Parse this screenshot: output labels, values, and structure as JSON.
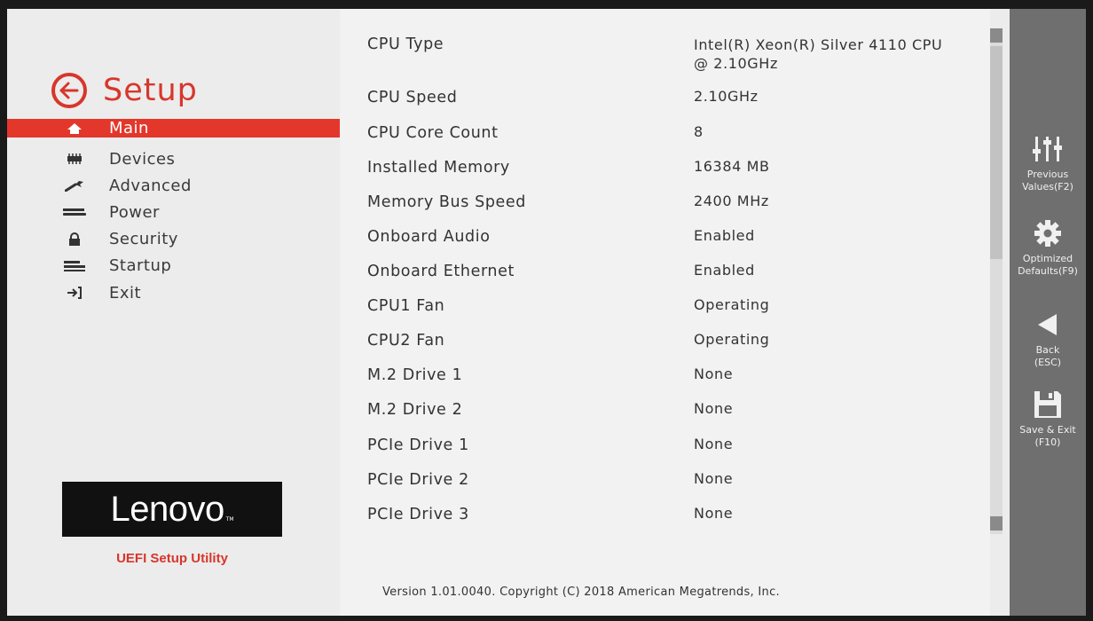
{
  "nav": {
    "title": "Setup",
    "items": [
      {
        "label": "Main",
        "icon": "home-icon",
        "active": true
      },
      {
        "label": "Devices",
        "icon": "chip-icon"
      },
      {
        "label": "Advanced",
        "icon": "wrench-icon"
      },
      {
        "label": "Power",
        "icon": "power-icon"
      },
      {
        "label": "Security",
        "icon": "lock-icon"
      },
      {
        "label": "Startup",
        "icon": "startup-icon"
      },
      {
        "label": "Exit",
        "icon": "exit-icon"
      }
    ],
    "brand": "Lenovo",
    "brand_tm": "TM",
    "subtitle": "UEFI Setup Utility"
  },
  "main": {
    "rows": [
      {
        "label": "CPU Type",
        "value": "Intel(R) Xeon(R) Silver 4110 CPU @ 2.10GHz"
      },
      {
        "label": "CPU Speed",
        "value": "2.10GHz"
      },
      {
        "label": "CPU Core Count",
        "value": "8"
      },
      {
        "label": "Installed Memory",
        "value": "16384 MB"
      },
      {
        "label": "Memory Bus Speed",
        "value": "2400 MHz"
      },
      {
        "label": "Onboard Audio",
        "value": "Enabled"
      },
      {
        "label": "Onboard Ethernet",
        "value": "Enabled"
      },
      {
        "label": "CPU1 Fan",
        "value": "Operating"
      },
      {
        "label": "CPU2 Fan",
        "value": "Operating"
      },
      {
        "label": "M.2 Drive 1",
        "value": "None"
      },
      {
        "label": "M.2 Drive 2",
        "value": "None"
      },
      {
        "label": "PCIe Drive 1",
        "value": "None"
      },
      {
        "label": "PCIe Drive 2",
        "value": "None"
      },
      {
        "label": "PCIe Drive 3",
        "value": "None"
      }
    ],
    "version": "Version 1.01.0040. Copyright (C) 2018 American Megatrends, Inc."
  },
  "actions": [
    {
      "label_line1": "Previous",
      "label_line2": "Values(F2)",
      "icon": "sliders-icon"
    },
    {
      "label_line1": "Optimized",
      "label_line2": "Defaults(F9)",
      "icon": "gear-icon"
    },
    {
      "label_line1": "Back",
      "label_line2": "(ESC)",
      "icon": "back-arrow-icon"
    },
    {
      "label_line1": "Save & Exit",
      "label_line2": "(F10)",
      "icon": "save-icon"
    }
  ],
  "colors": {
    "accent": "#e3372b",
    "panel": "#6f6f6f",
    "background": "#ececec"
  }
}
